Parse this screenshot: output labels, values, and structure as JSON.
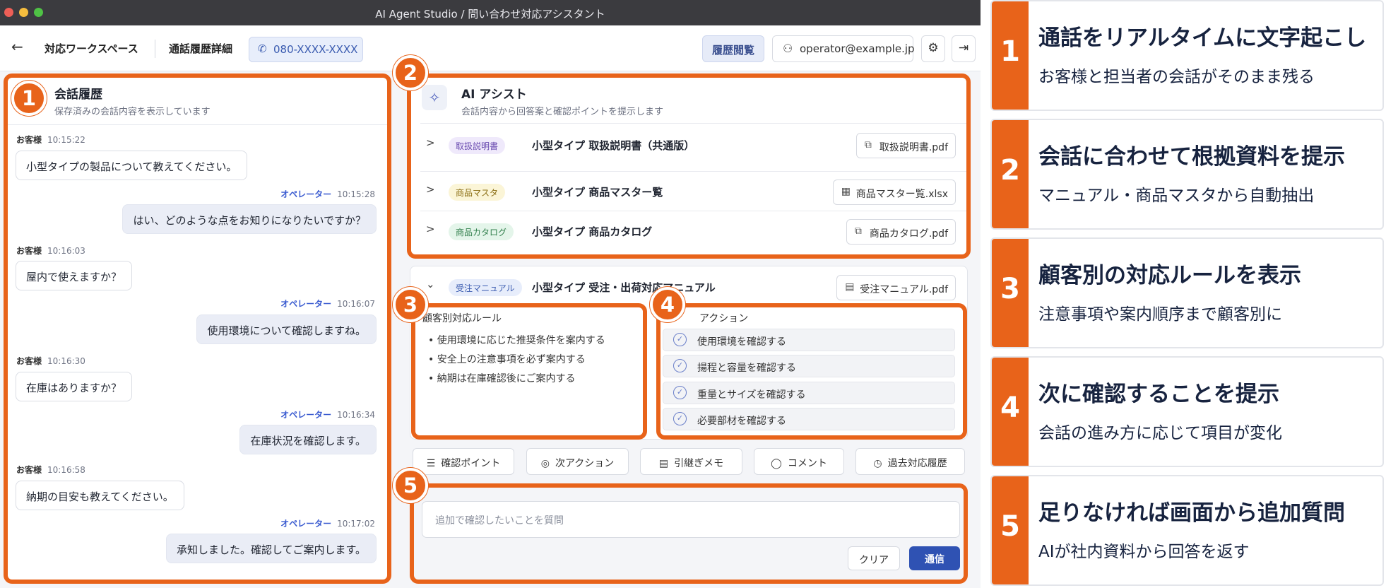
{
  "window": {
    "title": "AI Agent Studio / 問い合わせ対応アシスタント"
  },
  "topbar": {
    "back_icon": "←",
    "workspace": "対応ワークスペース",
    "page": "通話履歴詳細",
    "phone": "080-XXXX-XXXX",
    "history_button": "履歴閲覧",
    "user": "operator@example.jp"
  },
  "conversation": {
    "title": "会話履歴",
    "subtitle": "保存済みの会話内容を表示しています",
    "customer_label": "お客様",
    "operator_label": "オペレーター",
    "messages": [
      {
        "time": "10:15:22",
        "text": "小型タイプの製品について教えてください。"
      },
      {
        "time": "10:15:28",
        "text": "はい、どのような点をお知りになりたいですか？"
      },
      {
        "time": "10:16:03",
        "text": "屋内で使えますか？"
      },
      {
        "time": "10:16:07",
        "text": "使用環境について確認しますね。"
      },
      {
        "time": "10:16:30",
        "text": "在庫はありますか？"
      },
      {
        "time": "10:16:34",
        "text": "在庫状況を確認します。"
      },
      {
        "time": "10:16:58",
        "text": "納期の目安も教えてください。"
      },
      {
        "time": "10:17:02",
        "text": "承知しました。確認してご案内します。"
      }
    ]
  },
  "assist": {
    "title": "AI アシスト",
    "subtitle": "会話内容から回答案と確認ポイントを提示します",
    "documents": [
      {
        "tag": "取扱説明書",
        "name": "小型タイプ 取扱説明書（共通版）",
        "file": "取扱説明書.pdf",
        "tag_bg": "#efe9fb",
        "tag_color": "#6a4bb0"
      },
      {
        "tag": "商品マスタ",
        "name": "小型タイプ 商品マスター覧",
        "file": "商品マスター覧.xlsx",
        "tag_bg": "#fbf5d7",
        "tag_color": "#8a6d12"
      },
      {
        "tag": "商品カタログ",
        "name": "小型タイプ 商品カタログ",
        "file": "商品カタログ.pdf",
        "tag_bg": "#e4f5ea",
        "tag_color": "#2f7d4a"
      }
    ],
    "manual": {
      "tag": "受注マニュアル",
      "name": "小型タイプ 受注・出荷対応マニュアル",
      "file": "受注マニュアル.pdf",
      "tag_bg": "#e7edfb",
      "tag_color": "#3a5bb0"
    },
    "rules_title": "顧客別対応ルール",
    "rules": [
      "使用環境に応じた推奨条件を案内する",
      "安全上の注意事項を必ず案内する",
      "納期は在庫確認後にご案内する"
    ],
    "actions_title": "アクション",
    "actions": [
      "使用環境を確認する",
      "揚程と容量を確認する",
      "重量とサイズを確認する",
      "必要部材を確認する"
    ]
  },
  "toolbar": {
    "items": [
      {
        "icon": "☰",
        "label": "確認ポイント"
      },
      {
        "icon": "◎",
        "label": "次アクション"
      },
      {
        "icon": "▤",
        "label": "引継ぎメモ"
      },
      {
        "icon": "◯",
        "label": "コメント"
      },
      {
        "icon": "◷",
        "label": "過去対応履歴"
      }
    ]
  },
  "question": {
    "placeholder": "追加で確認したいことを質問",
    "clear": "クリア",
    "send": "通信"
  },
  "highlight_color": "#e8631a",
  "legend": [
    {
      "num": "1",
      "title": "通話をリアルタイムに文字起こし",
      "sub": "お客様と担当者の会話がそのまま残る"
    },
    {
      "num": "2",
      "title": "会話に合わせて根拠資料を提示",
      "sub": "マニュアル・商品マスタから自動抽出"
    },
    {
      "num": "3",
      "title": "顧客別の対応ルールを表示",
      "sub": "注意事項や案内順序まで顧客別に"
    },
    {
      "num": "4",
      "title": "次に確認することを提示",
      "sub": "会話の進み方に応じて項目が変化"
    },
    {
      "num": "5",
      "title": "足りなければ画面から追加質問",
      "sub": "AIが社内資料から回答を返す"
    }
  ]
}
